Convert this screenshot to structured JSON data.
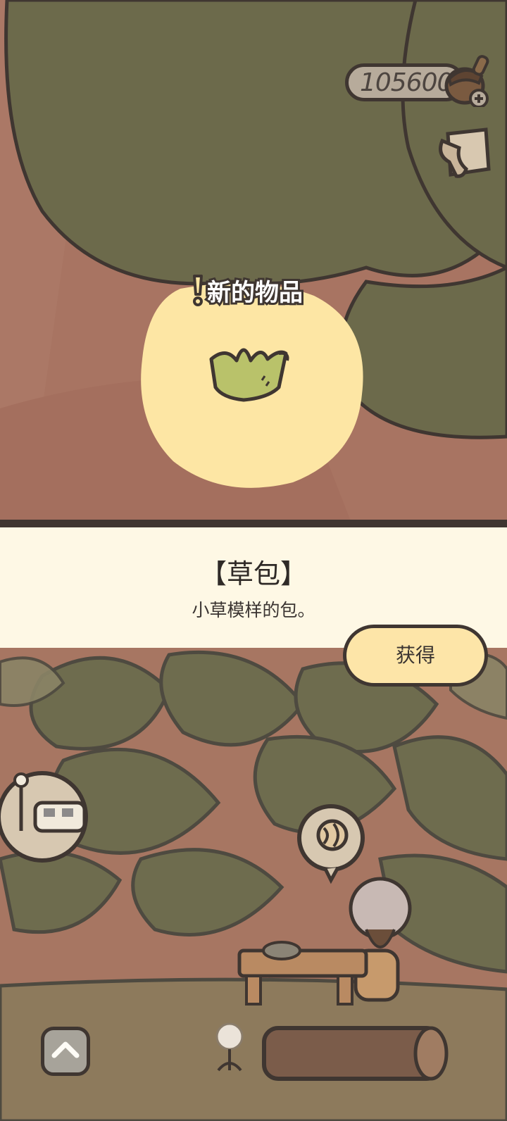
{
  "hud": {
    "currency_value": "105600",
    "currency_icon": "acorn-icon",
    "side_icon": "note-icon"
  },
  "popup": {
    "new_label": "新的物品",
    "item_icon": "grass-bag-icon",
    "item_name": "【草包】",
    "item_description": "小草模样的包。",
    "obtain_label": "获得"
  },
  "colors": {
    "panel_bg": "#fef8e5",
    "button_bg": "#fde5a8",
    "outline": "#3f3631",
    "tree_green": "#6b6848",
    "ground": "#a87462"
  }
}
